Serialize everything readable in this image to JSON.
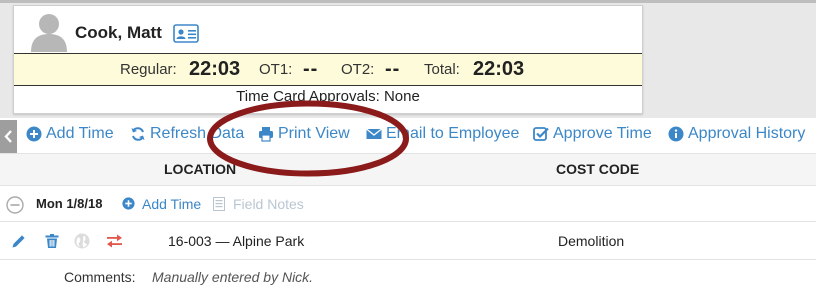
{
  "employee": {
    "name": "Cook, Matt",
    "hours": {
      "regular_label": "Regular:",
      "regular_value": "22:03",
      "ot1_label": "OT1:",
      "ot1_value": "--",
      "ot2_label": "OT2:",
      "ot2_value": "--",
      "total_label": "Total:",
      "total_value": "22:03"
    },
    "approvals_text": "Time Card Approvals: None"
  },
  "toolbar": {
    "add_time": "Add Time",
    "refresh": "Refresh Data",
    "print_view": "Print View",
    "email": "Email to Employee",
    "approve": "Approve Time",
    "approval_history": "Approval History"
  },
  "table": {
    "columns": [
      "LOCATION",
      "COST CODE"
    ],
    "day": {
      "label": "Mon 1/8/18",
      "add_time": "Add Time",
      "field_notes": "Field Notes"
    },
    "entry": {
      "location": "16-003 — Alpine Park",
      "cost_code": "Demolition"
    },
    "comment": {
      "label": "Comments:",
      "text": "Manually entered by Nick."
    }
  },
  "colors": {
    "link_blue": "#3b87c8",
    "hours_bg": "#fdfbd9",
    "annotation_red": "#8b1a1a"
  },
  "icons": [
    "user-avatar-icon",
    "id-card-icon",
    "plus-circle-icon",
    "refresh-icon",
    "print-icon",
    "envelope-icon",
    "check-square-icon",
    "info-circle-icon",
    "minus-circle-icon",
    "document-icon",
    "pencil-icon",
    "trash-icon",
    "globe-icon",
    "transfer-icon",
    "chevron-left-icon"
  ]
}
